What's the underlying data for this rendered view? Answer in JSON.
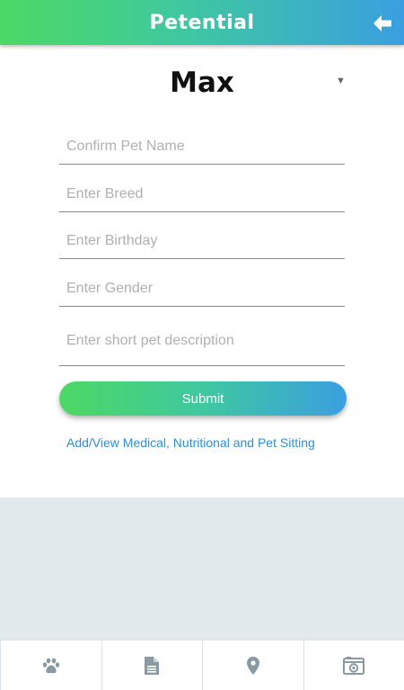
{
  "header": {
    "title": "Petential",
    "back_icon": "arrow-left-icon"
  },
  "pet_select": {
    "selected": "Max",
    "caret": "▼"
  },
  "form": {
    "pet_name_placeholder": "Confirm Pet Name",
    "breed_placeholder": "Enter Breed",
    "birthday_placeholder": "Enter Birthday",
    "gender_placeholder": "Enter Gender",
    "description_placeholder": "Enter short pet description",
    "submit_label": "Submit"
  },
  "link": {
    "label": "Add/View Medical, Nutritional and Pet Sitting"
  },
  "tabbar": {
    "tabs": [
      {
        "icon": "paw-icon"
      },
      {
        "icon": "document-icon"
      },
      {
        "icon": "map-pin-icon"
      },
      {
        "icon": "camera-icon"
      }
    ]
  },
  "colors": {
    "gradient_start": "#4cd964",
    "gradient_end": "#3a9fe0",
    "link": "#2f8fd6",
    "icon": "#8a9aa3",
    "panel_gray": "#e2e9ec"
  }
}
